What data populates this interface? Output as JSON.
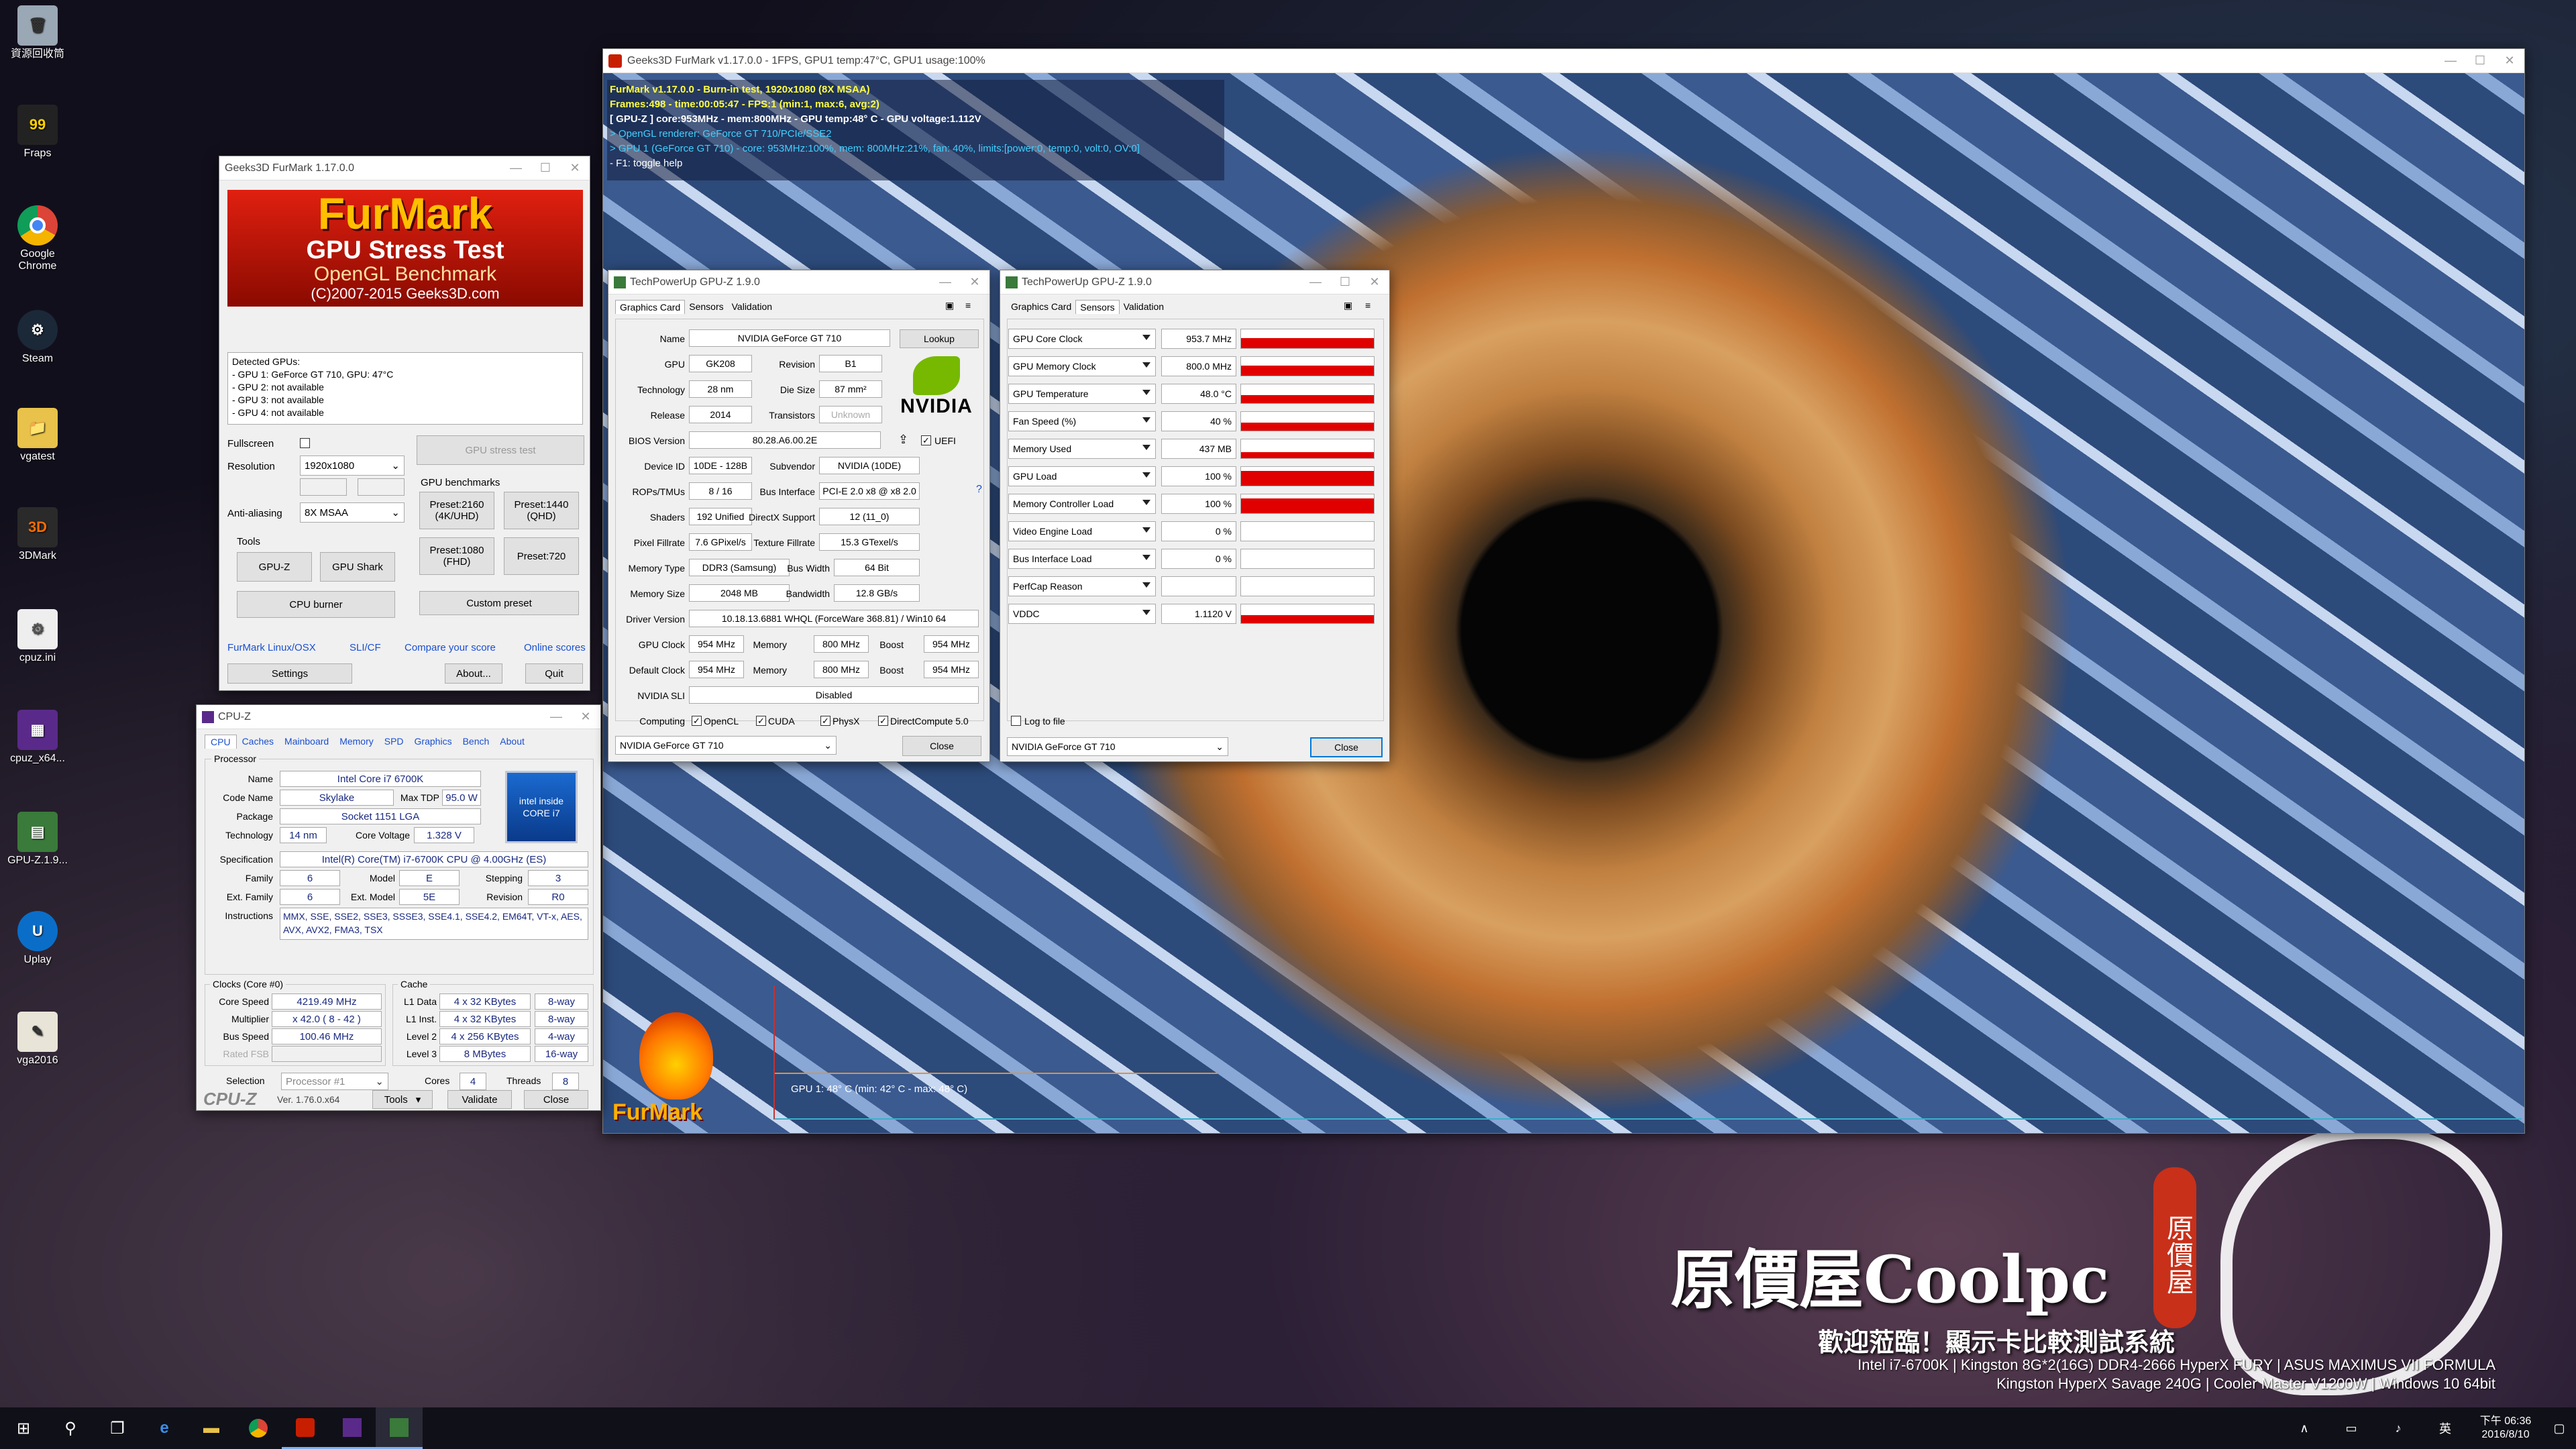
{
  "desktop": {
    "icons": [
      "資源回收筒",
      "Fraps",
      "Google Chrome",
      "Steam",
      "vgatest",
      "3DMark",
      "cpuz.ini",
      "cpuz_x64...",
      "GPU-Z.1.9...",
      "Uplay",
      "vga2016"
    ],
    "banner": {
      "brand": "原價屋Coolpc",
      "seal": "原價屋",
      "welcome": "歡迎蒞臨！顯示卡比較測試系統",
      "spec1": "Intel i7-6700K | Kingston 8G*2(16G) DDR4-2666 HyperX FURY | ASUS MAXIMUS VII FORMULA",
      "spec2": "Kingston HyperX Savage 240G | Cooler Master V1200W | Windows 10 64bit"
    }
  },
  "furmark_main": {
    "title": "Geeks3D FurMark v1.17.0.0 - 1FPS, GPU1 temp:47°C, GPU1 usage:100%",
    "overlay": [
      "FurMark v1.17.0.0 - Burn-in test, 1920x1080 (8X MSAA)",
      "Frames:498 - time:00:05:47 - FPS:1 (min:1, max:6, avg:2)",
      "[ GPU-Z ] core:953MHz - mem:800MHz - GPU temp:48° C - GPU voltage:1.112V",
      "> OpenGL renderer: GeForce GT 710/PCIe/SSE2",
      "> GPU 1 (GeForce GT 710) - core: 953MHz:100%, mem: 800MHz:21%, fan: 40%, limits:[power:0, temp:0, volt:0, OV:0]",
      "- F1: toggle help"
    ],
    "graph_label": "GPU 1: 48° C (min: 42° C - max: 48° C)",
    "logo": "FurMark"
  },
  "furmark_launcher": {
    "title": "Geeks3D FurMark 1.17.0.0",
    "banner_line1": "FurMark",
    "banner_line2": "GPU Stress Test",
    "banner_line3": "OpenGL Benchmark",
    "banner_line4": "(C)2007-2015 Geeks3D.com",
    "detected_title": "Detected GPUs:",
    "detected": [
      "- GPU 1: GeForce GT 710, GPU: 47°C",
      "- GPU 2: not available",
      "- GPU 3: not available",
      "- GPU 4: not available"
    ],
    "fullscreen_label": "Fullscreen",
    "resolution_label": "Resolution",
    "resolution": "1920x1080",
    "aa_label": "Anti-aliasing",
    "aa": "8X MSAA",
    "stress_btn": "GPU stress test",
    "benchmarks_label": "GPU benchmarks",
    "preset_2160": "Preset:2160 (4K/UHD)",
    "preset_1440": "Preset:1440 (QHD)",
    "preset_1080": "Preset:1080 (FHD)",
    "preset_720": "Preset:720",
    "custom_preset": "Custom preset",
    "tools_label": "Tools",
    "gpuz_btn": "GPU-Z",
    "gpushark_btn": "GPU Shark",
    "cpuburner_btn": "CPU burner",
    "links": [
      "FurMark Linux/OSX",
      "SLI/CF",
      "Compare your score",
      "Online scores"
    ],
    "settings_btn": "Settings",
    "about_btn": "About...",
    "quit_btn": "Quit"
  },
  "cpuz": {
    "title": "CPU-Z",
    "tabs": [
      "CPU",
      "Caches",
      "Mainboard",
      "Memory",
      "SPD",
      "Graphics",
      "Bench",
      "About"
    ],
    "processor_label": "Processor",
    "name_label": "Name",
    "name": "Intel Core i7 6700K",
    "codename_label": "Code Name",
    "codename": "Skylake",
    "maxtdp_label": "Max TDP",
    "maxtdp": "95.0 W",
    "package_label": "Package",
    "package": "Socket 1151 LGA",
    "technology_label": "Technology",
    "technology": "14 nm",
    "corevoltage_label": "Core Voltage",
    "corevoltage": "1.328 V",
    "spec_label": "Specification",
    "spec": "Intel(R) Core(TM) i7-6700K CPU @ 4.00GHz (ES)",
    "family_label": "Family",
    "family": "6",
    "model_label": "Model",
    "model": "E",
    "stepping_label": "Stepping",
    "stepping": "3",
    "extfamily_label": "Ext. Family",
    "extfamily": "6",
    "extmodel_label": "Ext. Model",
    "extmodel": "5E",
    "revision_label": "Revision",
    "revision": "R0",
    "instr_label": "Instructions",
    "instr": "MMX, SSE, SSE2, SSE3, SSSE3, SSE4.1, SSE4.2, EM64T, VT-x, AES, AVX, AVX2, FMA3, TSX",
    "clocks_label": "Clocks (Core #0)",
    "corespeed_label": "Core Speed",
    "corespeed": "4219.49 MHz",
    "multiplier_label": "Multiplier",
    "multiplier": "x 42.0 ( 8 - 42 )",
    "busspeed_label": "Bus Speed",
    "busspeed": "100.46 MHz",
    "ratedfsb_label": "Rated FSB",
    "cache_label": "Cache",
    "l1d_label": "L1 Data",
    "l1d": "4 x 32 KBytes",
    "l1d_way": "8-way",
    "l1i_label": "L1 Inst.",
    "l1i": "4 x 32 KBytes",
    "l1i_way": "8-way",
    "l2_label": "Level 2",
    "l2": "4 x 256 KBytes",
    "l2_way": "4-way",
    "l3_label": "Level 3",
    "l3": "8 MBytes",
    "l3_way": "16-way",
    "selection_label": "Selection",
    "selection": "Processor #1",
    "cores_label": "Cores",
    "cores": "4",
    "threads_label": "Threads",
    "threads": "8",
    "brand": "CPU-Z",
    "version": "Ver. 1.76.0.x64",
    "tools_btn": "Tools",
    "validate_btn": "Validate",
    "close_btn": "Close",
    "intel_badge": "intel inside CORE i7"
  },
  "gpuz_card": {
    "title": "TechPowerUp GPU-Z 1.9.0",
    "tabs": [
      "Graphics Card",
      "Sensors",
      "Validation"
    ],
    "name_label": "Name",
    "name": "NVIDIA GeForce GT 710",
    "lookup_btn": "Lookup",
    "gpu_label": "GPU",
    "gpu": "GK208",
    "revision_label": "Revision",
    "revision": "B1",
    "tech_label": "Technology",
    "tech": "28 nm",
    "diesize_label": "Die Size",
    "diesize": "87 mm²",
    "release_label": "Release",
    "release": "2014",
    "transistors_label": "Transistors",
    "transistors": "Unknown",
    "bios_label": "BIOS Version",
    "bios": "80.28.A6.00.2E",
    "uefi_label": "UEFI",
    "deviceid_label": "Device ID",
    "deviceid": "10DE - 128B",
    "subvendor_label": "Subvendor",
    "subvendor": "NVIDIA (10DE)",
    "rops_label": "ROPs/TMUs",
    "rops": "8 / 16",
    "businterface_label": "Bus Interface",
    "businterface": "PCI-E 2.0 x8 @ x8 2.0",
    "shaders_label": "Shaders",
    "shaders": "192 Unified",
    "directx_label": "DirectX Support",
    "directx": "12 (11_0)",
    "pixelfill_label": "Pixel Fillrate",
    "pixelfill": "7.6 GPixel/s",
    "texfill_label": "Texture Fillrate",
    "texfill": "15.3 GTexel/s",
    "memtype_label": "Memory Type",
    "memtype": "DDR3 (Samsung)",
    "buswidth_label": "Bus Width",
    "buswidth": "64 Bit",
    "memsize_label": "Memory Size",
    "memsize": "2048 MB",
    "bandwidth_label": "Bandwidth",
    "bandwidth": "12.8 GB/s",
    "driver_label": "Driver Version",
    "driver": "10.18.13.6881 WHQL (ForceWare 368.81) / Win10 64",
    "gpuclock_label": "GPU Clock",
    "gpuclock": "954 MHz",
    "memory_label": "Memory",
    "memclock": "800 MHz",
    "boost_label": "Boost",
    "boost": "954 MHz",
    "defclock_label": "Default Clock",
    "defclock": "954 MHz",
    "defmem": "800 MHz",
    "defboost": "954 MHz",
    "sli_label": "NVIDIA SLI",
    "sli": "Disabled",
    "computing_label": "Computing",
    "compute": [
      "OpenCL",
      "CUDA",
      "PhysX",
      "DirectCompute 5.0"
    ],
    "selector": "NVIDIA GeForce GT 710",
    "close_btn": "Close",
    "nvidia_logo": "NVIDIA"
  },
  "gpuz_sensors": {
    "title": "TechPowerUp GPU-Z 1.9.0",
    "tabs": [
      "Graphics Card",
      "Sensors",
      "Validation"
    ],
    "sensors": [
      {
        "name": "GPU Core Clock",
        "value": "953.7 MHz",
        "level": 0.85
      },
      {
        "name": "GPU Memory Clock",
        "value": "800.0 MHz",
        "level": 0.85
      },
      {
        "name": "GPU Temperature",
        "value": "48.0 °C",
        "level": 0.6
      },
      {
        "name": "Fan Speed (%)",
        "value": "40 %",
        "level": 0.6
      },
      {
        "name": "Memory Used",
        "value": "437 MB",
        "level": 0.3
      },
      {
        "name": "GPU Load",
        "value": "100 %",
        "level": 1.0
      },
      {
        "name": "Memory Controller Load",
        "value": "100 %",
        "level": 1.0
      },
      {
        "name": "Video Engine Load",
        "value": "0 %",
        "level": 0
      },
      {
        "name": "Bus Interface Load",
        "value": "0 %",
        "level": 0
      },
      {
        "name": "PerfCap Reason",
        "value": "",
        "level": 0
      },
      {
        "name": "VDDC",
        "value": "1.1120 V",
        "level": 0.6
      }
    ],
    "logtofile": "Log to file",
    "selector": "NVIDIA GeForce GT 710",
    "close_btn": "Close"
  },
  "taskbar": {
    "time": "下午 06:36",
    "date": "2016/8/10"
  }
}
